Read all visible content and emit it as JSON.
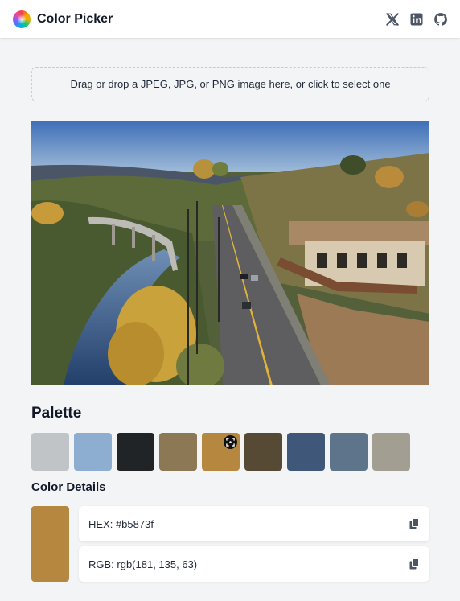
{
  "header": {
    "title": "Color Picker",
    "links": [
      "x-twitter-icon",
      "linkedin-icon",
      "github-icon"
    ]
  },
  "dropzone": {
    "text": "Drag or drop a JPEG, JPG, or PNG image here, or click to select one"
  },
  "palette": {
    "title": "Palette",
    "swatches": [
      "#c1c4c7",
      "#8daed1",
      "#212427",
      "#8c7855",
      "#b5873f",
      "#574a35",
      "#3f5778",
      "#5d748a",
      "#a39e92"
    ],
    "selected_index": 4
  },
  "details": {
    "title": "Color Details",
    "color": "#b5873f",
    "hex_text": "HEX: #b5873f",
    "rgb_text": "RGB: rgb(181, 135, 63)"
  },
  "icons": {
    "copy": "copy-icon",
    "selected": "crosshair-icon",
    "logo": "color-wheel-icon"
  }
}
